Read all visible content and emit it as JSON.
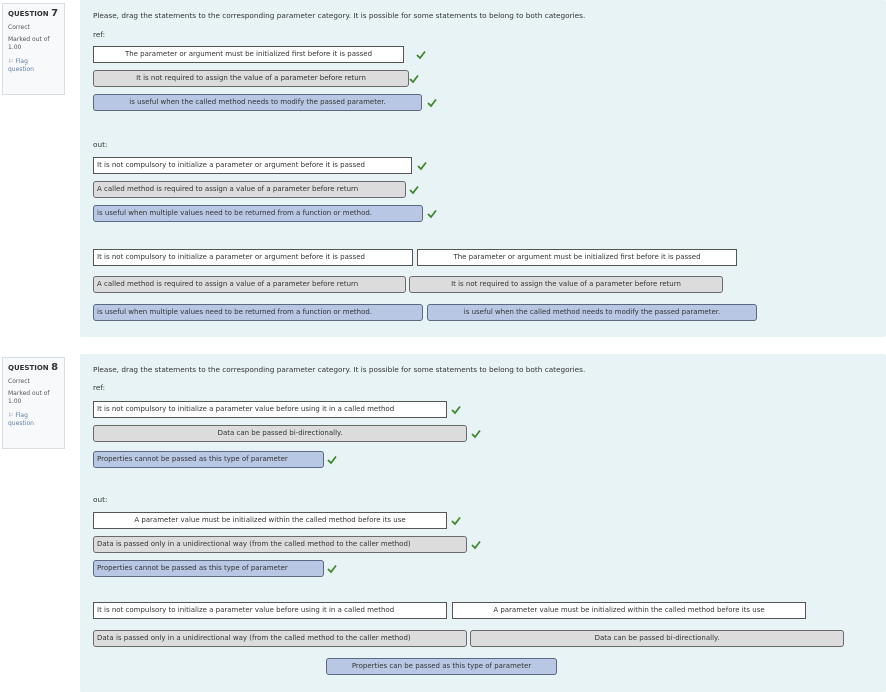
{
  "questions": [
    {
      "label_prefix": "QUESTION",
      "number": "7",
      "state": "Correct",
      "marked_out_of": "Marked out of",
      "mark_value": "1.00",
      "flag_line1": "Flag",
      "flag_line2": "question",
      "instruction": "Please, drag the statements to the corresponding parameter category. It is possible for some statements to belong to both categories.",
      "ref_label": "ref:",
      "ref_items": [
        "The parameter or argument must be initialized first before it is passed",
        "It is not required to assign the value of a parameter before return",
        "is useful when the called method needs to modify the passed parameter."
      ],
      "out_label": "out:",
      "out_items": [
        "It is not compulsory to initialize a parameter or argument before it is passed",
        "A called method is required to assign a value of a parameter before return",
        "is useful when multiple values need to be returned from a function or method."
      ],
      "choices": [
        "It is not compulsory to initialize a parameter or argument before it is passed",
        "The parameter or argument must be initialized first before it is passed",
        "A called method is required to assign a value of a parameter before return",
        "It is not required to assign the value of a parameter before return",
        "is useful when multiple values need to be returned from a function or method.",
        "is useful when the called method needs to modify the passed parameter."
      ]
    },
    {
      "label_prefix": "QUESTION",
      "number": "8",
      "state": "Correct",
      "marked_out_of": "Marked out of",
      "mark_value": "1.00",
      "flag_line1": "Flag",
      "flag_line2": "question",
      "instruction": "Please, drag the statements to the corresponding parameter category. It is possible for some statements to belong to both categories.",
      "ref_label": "ref:",
      "ref_items": [
        "It is not compulsory to initialize a parameter value before using it in a called method",
        "Data can be passed bi-directionally.",
        "Properties cannot be passed as this type of parameter"
      ],
      "out_label": "out:",
      "out_items": [
        "A parameter value must be initialized within the called method before its use",
        "Data is passed only in a unidirectional way (from the called method to the caller method)",
        "Properties cannot be passed as this type of parameter"
      ],
      "choices": [
        "It is not compulsory to initialize a parameter value before using it in a called method",
        "A parameter value must be initialized within the called method before its use",
        "Data is passed only in a unidirectional way (from the called method to the caller method)",
        "Data can be passed bi-directionally.",
        "Properties can be passed as this type of parameter"
      ]
    }
  ],
  "colors": {
    "check": "#3d8a2e",
    "flag_link": "#5a7fa8",
    "content_bg": "#e7f3f5"
  },
  "icons": {
    "correct": "check-icon",
    "flag": "flag-icon"
  }
}
